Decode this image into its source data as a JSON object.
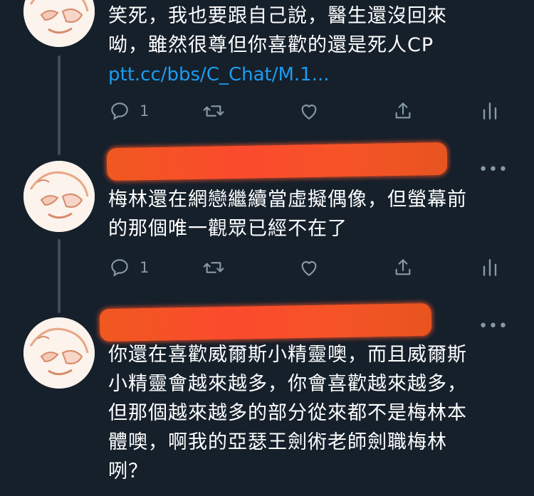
{
  "tweets": [
    {
      "body_lines": [
        "笑死，我也要跟自己說，醫生還沒回來",
        "呦，雖然很尊但你喜歡的還是死人CP"
      ],
      "link": "ptt.cc/bbs/C_Chat/M.1...",
      "reply_count": "1"
    },
    {
      "body_lines": [
        "梅林還在網戀繼續當虛擬偶像，但螢幕前",
        "的那個唯一觀眾已經不在了"
      ],
      "reply_count": "1",
      "more": "•••"
    },
    {
      "body_lines": [
        "你還在喜歡威爾斯小精靈噢，而且威爾斯",
        "小精靈會越來越多，你會喜歡越來越多，",
        "但那個越來越多的部分從來都不是梅林本",
        "體噢，啊我的亞瑟王劍術老師劍職梅林",
        "咧？"
      ],
      "more": "•••"
    }
  ],
  "icons": {
    "reply": "reply-icon",
    "retweet": "retweet-icon",
    "like": "heart-icon",
    "share": "share-icon",
    "analytics": "analytics-icon"
  },
  "colors": {
    "background": "#15202b",
    "link": "#1d9bf0",
    "muted": "#8899a6",
    "redaction": "#f5522a"
  }
}
